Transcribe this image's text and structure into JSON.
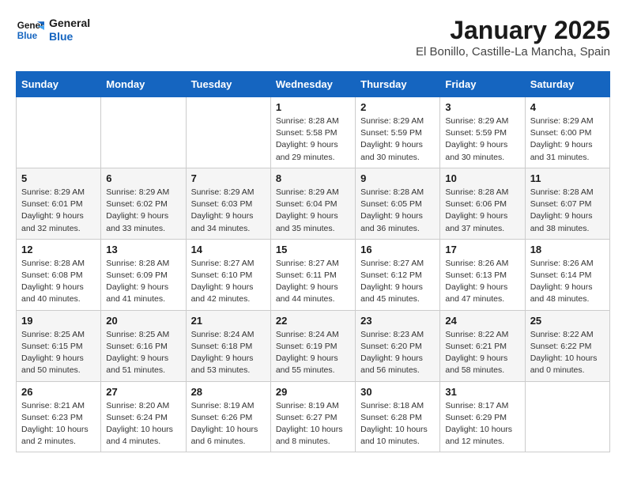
{
  "logo": {
    "line1": "General",
    "line2": "Blue"
  },
  "title": "January 2025",
  "location": "El Bonillo, Castille-La Mancha, Spain",
  "weekdays": [
    "Sunday",
    "Monday",
    "Tuesday",
    "Wednesday",
    "Thursday",
    "Friday",
    "Saturday"
  ],
  "weeks": [
    [
      {
        "day": "",
        "info": ""
      },
      {
        "day": "",
        "info": ""
      },
      {
        "day": "",
        "info": ""
      },
      {
        "day": "1",
        "info": "Sunrise: 8:28 AM\nSunset: 5:58 PM\nDaylight: 9 hours and 29 minutes."
      },
      {
        "day": "2",
        "info": "Sunrise: 8:29 AM\nSunset: 5:59 PM\nDaylight: 9 hours and 30 minutes."
      },
      {
        "day": "3",
        "info": "Sunrise: 8:29 AM\nSunset: 5:59 PM\nDaylight: 9 hours and 30 minutes."
      },
      {
        "day": "4",
        "info": "Sunrise: 8:29 AM\nSunset: 6:00 PM\nDaylight: 9 hours and 31 minutes."
      }
    ],
    [
      {
        "day": "5",
        "info": "Sunrise: 8:29 AM\nSunset: 6:01 PM\nDaylight: 9 hours and 32 minutes."
      },
      {
        "day": "6",
        "info": "Sunrise: 8:29 AM\nSunset: 6:02 PM\nDaylight: 9 hours and 33 minutes."
      },
      {
        "day": "7",
        "info": "Sunrise: 8:29 AM\nSunset: 6:03 PM\nDaylight: 9 hours and 34 minutes."
      },
      {
        "day": "8",
        "info": "Sunrise: 8:29 AM\nSunset: 6:04 PM\nDaylight: 9 hours and 35 minutes."
      },
      {
        "day": "9",
        "info": "Sunrise: 8:28 AM\nSunset: 6:05 PM\nDaylight: 9 hours and 36 minutes."
      },
      {
        "day": "10",
        "info": "Sunrise: 8:28 AM\nSunset: 6:06 PM\nDaylight: 9 hours and 37 minutes."
      },
      {
        "day": "11",
        "info": "Sunrise: 8:28 AM\nSunset: 6:07 PM\nDaylight: 9 hours and 38 minutes."
      }
    ],
    [
      {
        "day": "12",
        "info": "Sunrise: 8:28 AM\nSunset: 6:08 PM\nDaylight: 9 hours and 40 minutes."
      },
      {
        "day": "13",
        "info": "Sunrise: 8:28 AM\nSunset: 6:09 PM\nDaylight: 9 hours and 41 minutes."
      },
      {
        "day": "14",
        "info": "Sunrise: 8:27 AM\nSunset: 6:10 PM\nDaylight: 9 hours and 42 minutes."
      },
      {
        "day": "15",
        "info": "Sunrise: 8:27 AM\nSunset: 6:11 PM\nDaylight: 9 hours and 44 minutes."
      },
      {
        "day": "16",
        "info": "Sunrise: 8:27 AM\nSunset: 6:12 PM\nDaylight: 9 hours and 45 minutes."
      },
      {
        "day": "17",
        "info": "Sunrise: 8:26 AM\nSunset: 6:13 PM\nDaylight: 9 hours and 47 minutes."
      },
      {
        "day": "18",
        "info": "Sunrise: 8:26 AM\nSunset: 6:14 PM\nDaylight: 9 hours and 48 minutes."
      }
    ],
    [
      {
        "day": "19",
        "info": "Sunrise: 8:25 AM\nSunset: 6:15 PM\nDaylight: 9 hours and 50 minutes."
      },
      {
        "day": "20",
        "info": "Sunrise: 8:25 AM\nSunset: 6:16 PM\nDaylight: 9 hours and 51 minutes."
      },
      {
        "day": "21",
        "info": "Sunrise: 8:24 AM\nSunset: 6:18 PM\nDaylight: 9 hours and 53 minutes."
      },
      {
        "day": "22",
        "info": "Sunrise: 8:24 AM\nSunset: 6:19 PM\nDaylight: 9 hours and 55 minutes."
      },
      {
        "day": "23",
        "info": "Sunrise: 8:23 AM\nSunset: 6:20 PM\nDaylight: 9 hours and 56 minutes."
      },
      {
        "day": "24",
        "info": "Sunrise: 8:22 AM\nSunset: 6:21 PM\nDaylight: 9 hours and 58 minutes."
      },
      {
        "day": "25",
        "info": "Sunrise: 8:22 AM\nSunset: 6:22 PM\nDaylight: 10 hours and 0 minutes."
      }
    ],
    [
      {
        "day": "26",
        "info": "Sunrise: 8:21 AM\nSunset: 6:23 PM\nDaylight: 10 hours and 2 minutes."
      },
      {
        "day": "27",
        "info": "Sunrise: 8:20 AM\nSunset: 6:24 PM\nDaylight: 10 hours and 4 minutes."
      },
      {
        "day": "28",
        "info": "Sunrise: 8:19 AM\nSunset: 6:26 PM\nDaylight: 10 hours and 6 minutes."
      },
      {
        "day": "29",
        "info": "Sunrise: 8:19 AM\nSunset: 6:27 PM\nDaylight: 10 hours and 8 minutes."
      },
      {
        "day": "30",
        "info": "Sunrise: 8:18 AM\nSunset: 6:28 PM\nDaylight: 10 hours and 10 minutes."
      },
      {
        "day": "31",
        "info": "Sunrise: 8:17 AM\nSunset: 6:29 PM\nDaylight: 10 hours and 12 minutes."
      },
      {
        "day": "",
        "info": ""
      }
    ]
  ]
}
